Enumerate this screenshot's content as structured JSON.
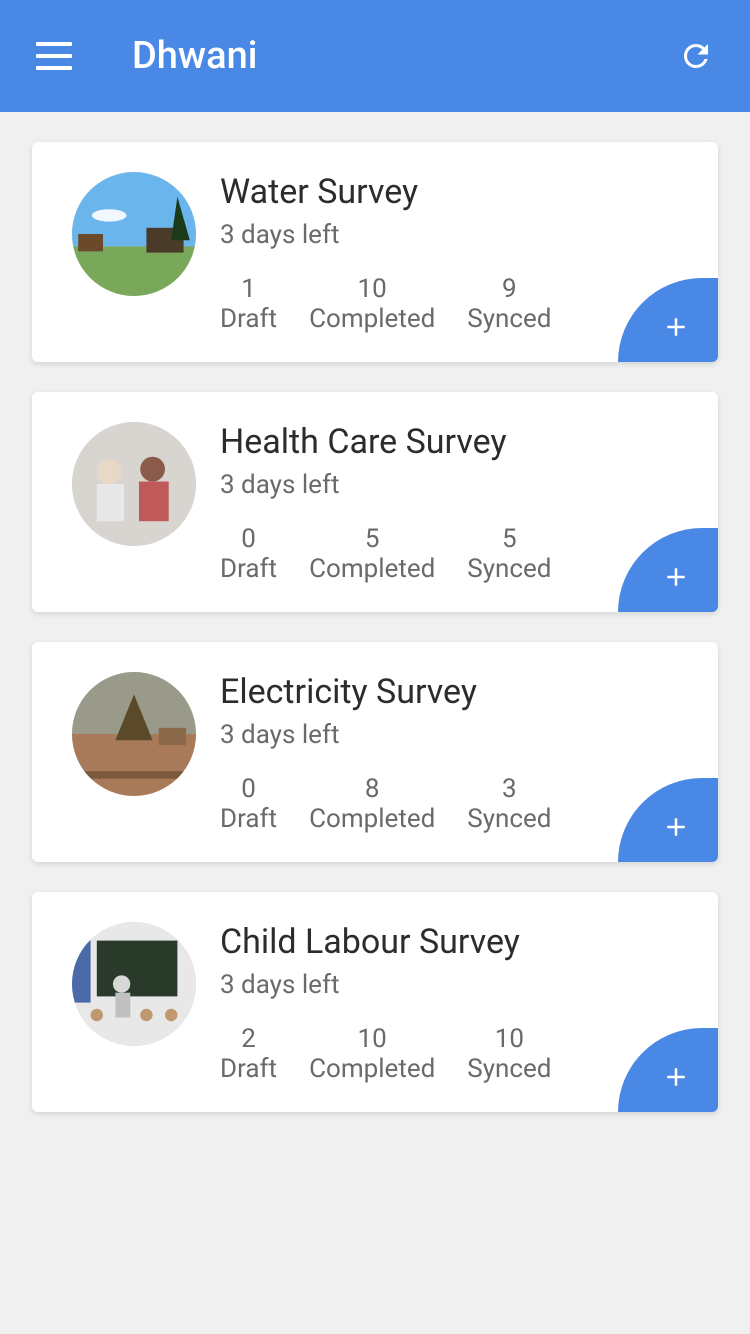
{
  "header": {
    "title": "Dhwani"
  },
  "stat_labels": {
    "draft": "Draft",
    "completed": "Completed",
    "synced": "Synced"
  },
  "surveys": [
    {
      "title": "Water Survey",
      "days_left": "3 days left",
      "draft": "1",
      "completed": "10",
      "synced": "9"
    },
    {
      "title": "Health Care Survey",
      "days_left": "3 days left",
      "draft": "0",
      "completed": "5",
      "synced": "5"
    },
    {
      "title": "Electricity Survey",
      "days_left": "3 days left",
      "draft": "0",
      "completed": "8",
      "synced": "3"
    },
    {
      "title": "Child Labour Survey",
      "days_left": "3 days left",
      "draft": "2",
      "completed": "10",
      "synced": "10"
    }
  ]
}
